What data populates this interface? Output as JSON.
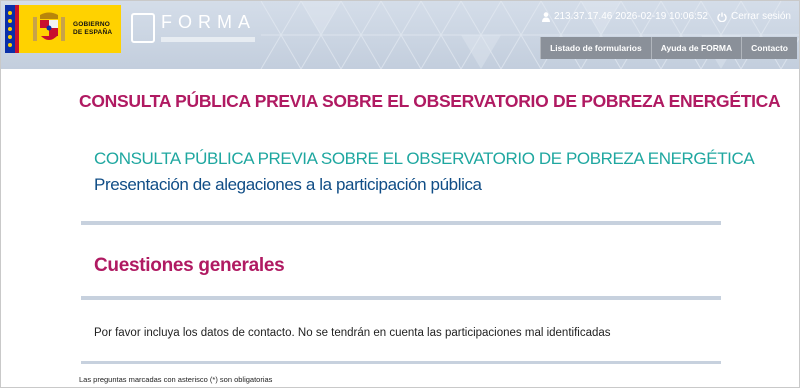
{
  "header": {
    "gov_logo_text": [
      "GOBIERNO",
      "DE ESPAÑA"
    ],
    "app_logo_word": "FORMA",
    "session_info": "213.37.17.46 2026-02-19 10:06:52",
    "logout_label": "Cerrar sesión",
    "nav": [
      {
        "label": "Listado de formularios"
      },
      {
        "label": "Ayuda de FORMA"
      },
      {
        "label": "Contacto"
      }
    ]
  },
  "main": {
    "page_title": "CONSULTA PÚBLICA PREVIA SOBRE EL OBSERVATORIO DE POBREZA ENERGÉTICA",
    "form_title": "CONSULTA PÚBLICA PREVIA SOBRE EL OBSERVATORIO DE POBREZA ENERGÉTICA",
    "form_subtitle": "Presentación de alegaciones a la participación pública",
    "section_title": "Cuestiones generales",
    "info_text": "Por favor incluya los datos de contacto. No se tendrán en cuenta las participaciones mal identificadas",
    "footnote": "Las preguntas marcadas con asterisco (*) son obligatorias"
  },
  "colors": {
    "title_magenta": "#b01a62",
    "title_teal": "#1fa7a0",
    "subtitle_blue": "#104d86",
    "nav_bg": "#8a9099",
    "gov_yellow": "#ffd200"
  },
  "icons": [
    "user-icon",
    "power-icon",
    "forma-logo-icon",
    "spain-coat-of-arms-icon"
  ]
}
